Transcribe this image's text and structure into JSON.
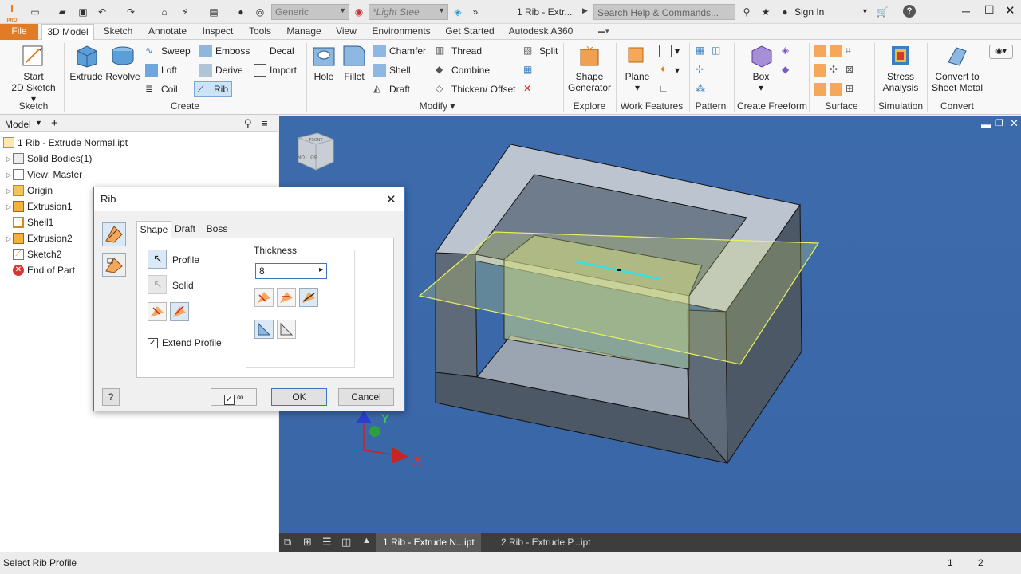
{
  "app": {
    "title": "1 Rib - Extr...",
    "material": "Generic",
    "appearance": "*Light Stee",
    "search_placeholder": "Search Help & Commands...",
    "sign_in": "Sign In",
    "help": "?",
    "brand_color": "#e27b25"
  },
  "menu": [
    "File",
    "3D Model",
    "Sketch",
    "Annotate",
    "Inspect",
    "Tools",
    "Manage",
    "View",
    "Environments",
    "Get Started",
    "Autodesk A360"
  ],
  "ribbon": {
    "sketch": {
      "btn": "Start",
      "btn2": "2D Sketch",
      "panel": "Sketch"
    },
    "create": {
      "extrude": "Extrude",
      "revolve": "Revolve",
      "sweep": "Sweep",
      "emboss": "Emboss",
      "decal": "Decal",
      "loft": "Loft",
      "derive": "Derive",
      "import": "Import",
      "coil": "Coil",
      "rib": "Rib",
      "panel": "Create"
    },
    "modify": {
      "hole": "Hole",
      "fillet": "Fillet",
      "chamfer": "Chamfer",
      "thread": "Thread",
      "shell": "Shell",
      "combine": "Combine",
      "draft": "Draft",
      "thicken": "Thicken/ Offset",
      "split": "Split",
      "panel": "Modify"
    },
    "explore": {
      "btn": "Shape",
      "btn2": "Generator",
      "panel": "Explore"
    },
    "work": {
      "btn": "Plane",
      "panel": "Work Features"
    },
    "pattern": {
      "panel": "Pattern"
    },
    "freeform": {
      "btn": "Box",
      "panel": "Create Freeform"
    },
    "surface": {
      "panel": "Surface"
    },
    "simulation": {
      "btn": "Stress",
      "btn2": "Analysis",
      "panel": "Simulation"
    },
    "convert": {
      "btn": "Convert to",
      "btn2": "Sheet Metal",
      "panel": "Convert"
    }
  },
  "browser": {
    "title": "Model",
    "root": "1 Rib - Extrude Normal.ipt",
    "items": [
      "Solid Bodies(1)",
      "View: Master",
      "Origin",
      "Extrusion1",
      "Shell1",
      "Extrusion2",
      "Sketch2",
      "End of Part"
    ]
  },
  "dialog": {
    "title": "Rib",
    "tabs": [
      "Shape",
      "Draft",
      "Boss"
    ],
    "profile": "Profile",
    "solid": "Solid",
    "extend_profile": "Extend Profile",
    "thickness_label": "Thickness",
    "thickness_value": "8",
    "ok": "OK",
    "cancel": "Cancel"
  },
  "viewcube": {
    "front": "FRONT",
    "bottom": "BOTTOM"
  },
  "triad": {
    "x": "X",
    "y": "Y"
  },
  "doc_tabs": [
    "1 Rib - Extrude N...ipt",
    "2 Rib - Extrude P...ipt"
  ],
  "status": {
    "text": "Select Rib Profile",
    "count1": "1",
    "count2": "2"
  }
}
